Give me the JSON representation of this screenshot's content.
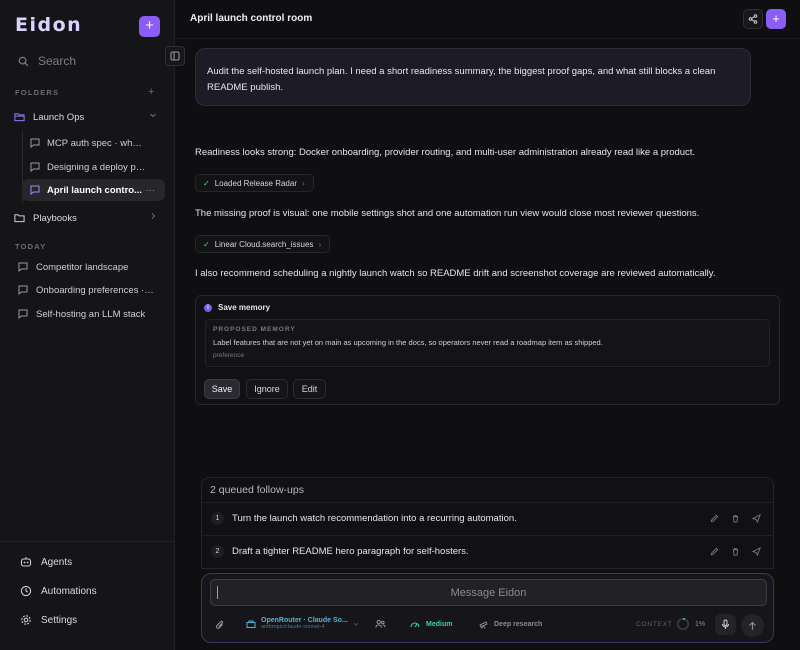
{
  "app": {
    "logo": "Eidon",
    "new_chat_glyph": "+"
  },
  "sidebar": {
    "search_placeholder": "Search",
    "folders_label": "FOLDERS",
    "folders_add_glyph": "+",
    "folders": [
      {
        "label": "Launch Ops",
        "expanded": true,
        "threads": [
          {
            "label": "MCP auth spec · what c...",
            "active": false
          },
          {
            "label": "Designing a deploy pipel...",
            "active": false
          },
          {
            "label": "April launch contro...",
            "active": true,
            "more": "···"
          }
        ]
      },
      {
        "label": "Playbooks",
        "expanded": false
      }
    ],
    "today_label": "TODAY",
    "today": [
      {
        "label": "Competitor landscape"
      },
      {
        "label": "Onboarding preferences · s..."
      },
      {
        "label": "Self-hosting an LLM stack"
      }
    ],
    "bottom_nav": [
      {
        "label": "Agents",
        "icon": "agents-icon"
      },
      {
        "label": "Automations",
        "icon": "clock-icon"
      },
      {
        "label": "Settings",
        "icon": "gear-icon"
      }
    ]
  },
  "header": {
    "title": "April launch control room",
    "plus_glyph": "+"
  },
  "conversation": {
    "user_message": "Audit the self-hosted launch plan. I need a short readiness summary, the biggest proof gaps, and what still blocks a clean README publish.",
    "assistant": {
      "para1": "Readiness looks strong: Docker onboarding, provider routing, and multi-user administration already read like a product.",
      "tool1": "Loaded Release Radar",
      "para2": "The missing proof is visual: one mobile settings shot and one automation run view would close most reviewer questions.",
      "tool2": "Linear Cloud.search_issues",
      "para3": "I also recommend scheduling a nightly launch watch so README drift and screenshot coverage are reviewed automatically.",
      "tool_ok_glyph": "✓",
      "tool_arrow_glyph": "›"
    },
    "memory": {
      "title": "Save memory",
      "info_glyph": "i",
      "label": "PROPOSED MEMORY",
      "text": "Label features that are not yet on main as upcoming in the docs, so operators never read a roadmap item as shipped.",
      "tag": "preference",
      "save": "Save",
      "ignore": "Ignore",
      "edit": "Edit"
    }
  },
  "queue": {
    "title": "2 queued follow-ups",
    "items": [
      {
        "num": "1",
        "text": "Turn the launch watch recommendation into a recurring automation."
      },
      {
        "num": "2",
        "text": "Draft a tighter README hero paragraph for self-hosters."
      }
    ]
  },
  "composer": {
    "placeholder": "Message Eidon",
    "value": "",
    "model_name": "OpenRouter · Claude So...",
    "model_id": "anthropic/claude-sonnet-4",
    "effort": "Medium",
    "deep_research": "Deep research",
    "context_label": "CONTEXT",
    "context_pct": "1%",
    "context_fraction": 0.01
  },
  "colors": {
    "accent": "#8b5cf6",
    "model": "#4fb3d9",
    "effort": "#34d399",
    "ok": "#4ade80"
  }
}
